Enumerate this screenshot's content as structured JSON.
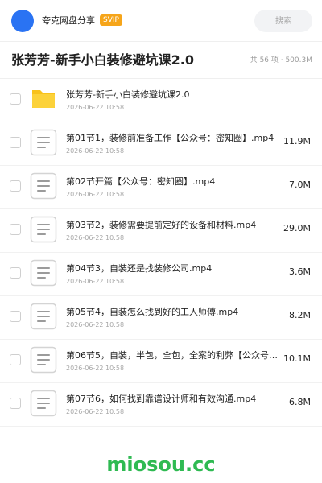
{
  "header": {
    "share_name": "夸克网盘分享",
    "badge": "SVIP",
    "search_placeholder": "搜索"
  },
  "folder": {
    "title": "张芳芳-新手小白装修避坑课2.0",
    "summary": "共 56 项 · 500.3M"
  },
  "files": [
    {
      "name": "张芳芳-新手小白装修避坑课2.0",
      "date": "2026-06-22 10:58",
      "size": "",
      "type": "folder",
      "icon": "folder-icon"
    },
    {
      "name": "第01节1，装修前准备工作【公众号：密知圈】.mp4",
      "date": "2026-06-22 10:58",
      "size": "11.9M",
      "type": "file",
      "icon": "video-file-icon"
    },
    {
      "name": "第02节开篇【公众号：密知圈】.mp4",
      "date": "2026-06-22 10:58",
      "size": "7.0M",
      "type": "file",
      "icon": "video-file-icon"
    },
    {
      "name": "第03节2，装修需要提前定好的设备和材料.mp4",
      "date": "2026-06-22 10:58",
      "size": "29.0M",
      "type": "file",
      "icon": "video-file-icon"
    },
    {
      "name": "第04节3，自装还是找装修公司.mp4",
      "date": "2026-06-22 10:58",
      "size": "3.6M",
      "type": "file",
      "icon": "video-file-icon"
    },
    {
      "name": "第05节4，自装怎么找到好的工人师傅.mp4",
      "date": "2026-06-22 10:58",
      "size": "8.2M",
      "type": "file",
      "icon": "video-file-icon"
    },
    {
      "name": "第06节5，自装，半包，全包，全案的利弊【公众号：…",
      "date": "2026-06-22 10:58",
      "size": "10.1M",
      "type": "file",
      "icon": "video-file-icon"
    },
    {
      "name": "第07节6，如何找到靠谱设计师和有效沟通.mp4",
      "date": "2026-06-22 10:58",
      "size": "6.8M",
      "type": "file",
      "icon": "video-file-icon"
    }
  ],
  "colors": {
    "accent": "#2a73f3",
    "svip": "#f6a51a",
    "folder": "#f8c21c",
    "brand_green": "#2fba52"
  },
  "footer": {
    "brand": "miosou.cc"
  }
}
